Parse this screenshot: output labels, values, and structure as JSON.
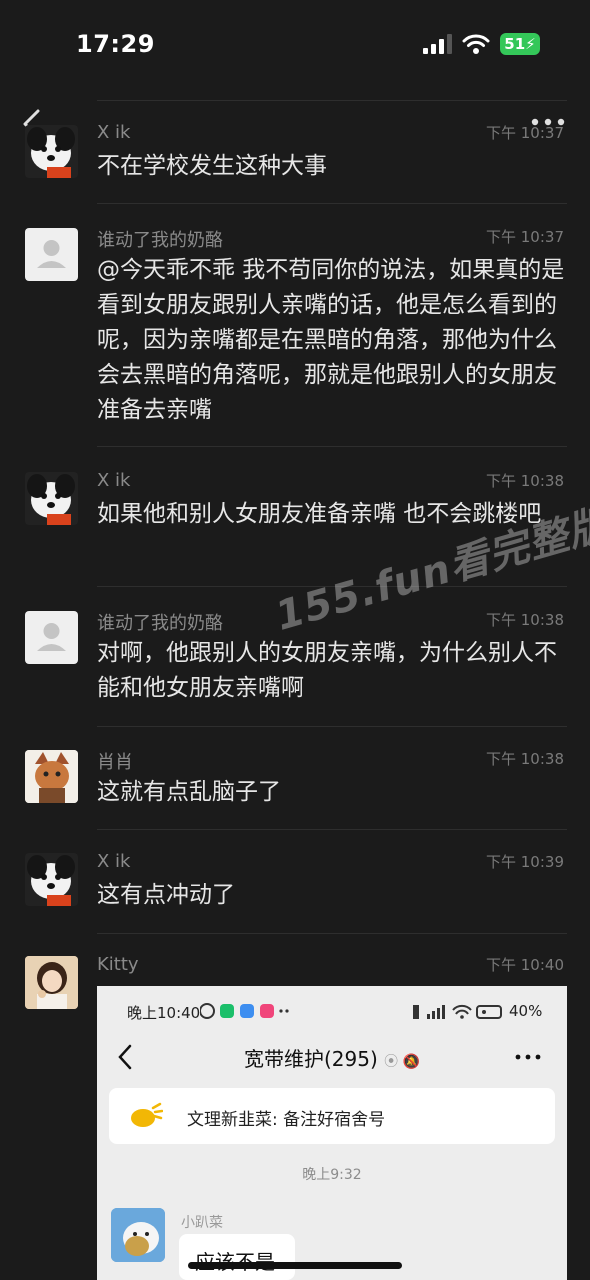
{
  "status_bar": {
    "time": "17:29",
    "battery": "51"
  },
  "comments": [
    {
      "name": "X ik",
      "time": "下午 10:37",
      "text": "不在学校发生这种大事",
      "avatar": "dog-avatar"
    },
    {
      "name": "谁动了我的奶酪",
      "time": "下午 10:37",
      "text": "@今天乖不乖 我不苟同你的说法，如果真的是看到女朋友跟别人亲嘴的话，他是怎么看到的呢，因为亲嘴都是在黑暗的角落，那他为什么会去黑暗的角落呢，那就是他跟别人的女朋友准备去亲嘴",
      "avatar": "default-avatar"
    },
    {
      "name": "X ik",
      "time": "下午 10:38",
      "text": "如果他和别人女朋友准备亲嘴 也不会跳楼吧",
      "avatar": "dog-avatar"
    },
    {
      "name": "谁动了我的奶酪",
      "time": "下午 10:38",
      "text": "对啊，他跟别人的女朋友亲嘴，为什么别人不能和他女朋友亲嘴啊",
      "avatar": "default-avatar"
    },
    {
      "name": "肖肖",
      "time": "下午 10:38",
      "text": "这就有点乱脑子了",
      "avatar": "cat-avatar"
    },
    {
      "name": "X ik",
      "time": "下午 10:39",
      "text": "这有点冲动了",
      "avatar": "dog-avatar"
    },
    {
      "name": "Kitty",
      "time": "下午 10:40",
      "text": "",
      "avatar": "girl-avatar"
    }
  ],
  "watermark": "155.fun看完整版",
  "embedded_screenshot": {
    "status_time": "晚上10:40",
    "battery": "40%",
    "chat_title": "宽带维护(295)",
    "notice_text": "文理新韭菜: 备注好宿舍号",
    "timestamp": "晚上9:32",
    "sender_name": "小趴菜",
    "message_text": "应该不是"
  },
  "colors": {
    "background": "#1b1b1b",
    "battery_green": "#34c759"
  }
}
